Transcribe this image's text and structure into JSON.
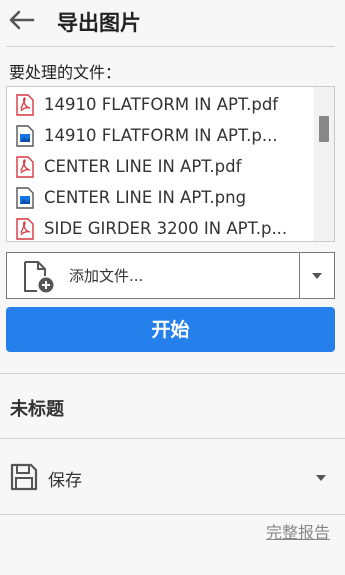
{
  "header": {
    "title": "导出图片"
  },
  "files": {
    "label": "要处理的文件：",
    "items": [
      {
        "name": "14910 FLATFORM IN APT.pdf",
        "icon": "pdf-file-icon"
      },
      {
        "name": "14910 FLATFORM IN APT.p...",
        "icon": "image-file-icon"
      },
      {
        "name": "CENTER LINE IN APT.pdf",
        "icon": "pdf-file-icon"
      },
      {
        "name": "CENTER LINE IN APT.png",
        "icon": "image-file-icon"
      },
      {
        "name": "SIDE GIRDER 3200 IN APT.p...",
        "icon": "pdf-file-icon"
      }
    ]
  },
  "add": {
    "label": "添加文件..."
  },
  "start": {
    "label": "开始"
  },
  "untitled": {
    "label": "未标题"
  },
  "save": {
    "label": "保存"
  },
  "report": {
    "label": "完整报告"
  },
  "colors": {
    "accent": "#2680eb",
    "pdf_red": "#d7373f",
    "image_blue": "#1473e6"
  }
}
